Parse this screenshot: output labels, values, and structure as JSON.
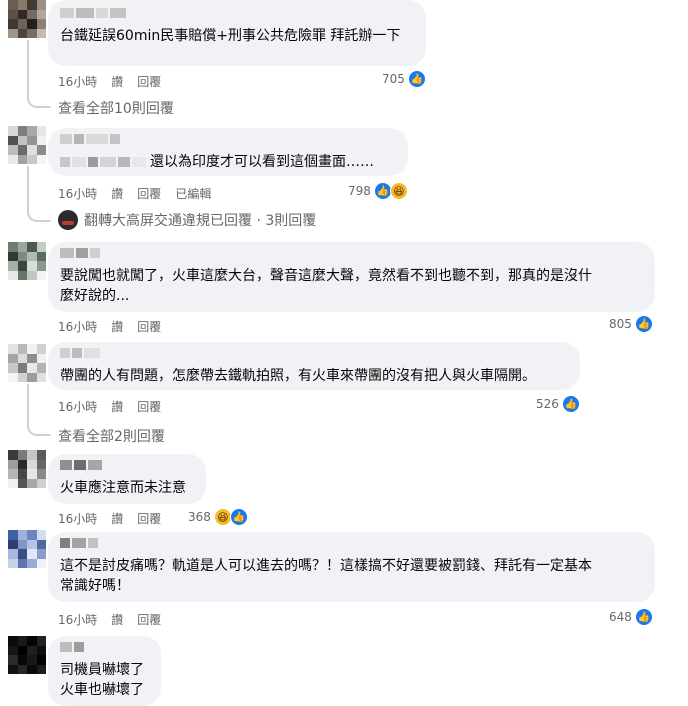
{
  "actions": {
    "like": "讚",
    "reply": "回覆"
  },
  "colors": {
    "like": "#1877f2",
    "haha": "#f7b928",
    "meta": "#65676b",
    "bubble": "#f0f2f5"
  },
  "comments": [
    {
      "text": "台鐵延誤60min民事賠償+刑事公共危險罪 拜託辦一下",
      "time": "16小時",
      "count": "705",
      "reactions": [
        "like-icon"
      ],
      "view_replies": "查看全部10則回覆"
    },
    {
      "text": "還以為印度才可以看到這個畫面……",
      "time": "16小時",
      "edited": "已編輯",
      "count": "798",
      "reactions": [
        "like-icon",
        "haha-icon"
      ],
      "reply_summary": "翻轉大高屏交通違規已回覆 · 3則回覆"
    },
    {
      "text": "要說闖也就闖了，火車這麼大台，聲音這麼大聲，竟然看不到也聽不到，那真的是沒什\n麼好說的...",
      "time": "16小時",
      "count": "805",
      "reactions": [
        "like-icon"
      ]
    },
    {
      "text": "帶團的人有問題，怎麼帶去鐵軌拍照，有火車來帶團的沒有把人與火車隔開。",
      "time": "16小時",
      "count": "526",
      "reactions": [
        "like-icon"
      ],
      "view_replies": "查看全部2則回覆"
    },
    {
      "text": "火車應注意而未注意",
      "time": "16小時",
      "count": "368",
      "reactions": [
        "haha-icon",
        "like-icon"
      ]
    },
    {
      "text": "這不是討皮痛嗎？軌道是人可以進去的嗎？！這樣搞不好還要被罰錢、拜託有一定基本\n常識好嗎！",
      "time": "16小時",
      "count": "648",
      "reactions": [
        "like-icon"
      ]
    },
    {
      "text": "司機員嚇壞了\n火車也嚇壞了"
    }
  ]
}
